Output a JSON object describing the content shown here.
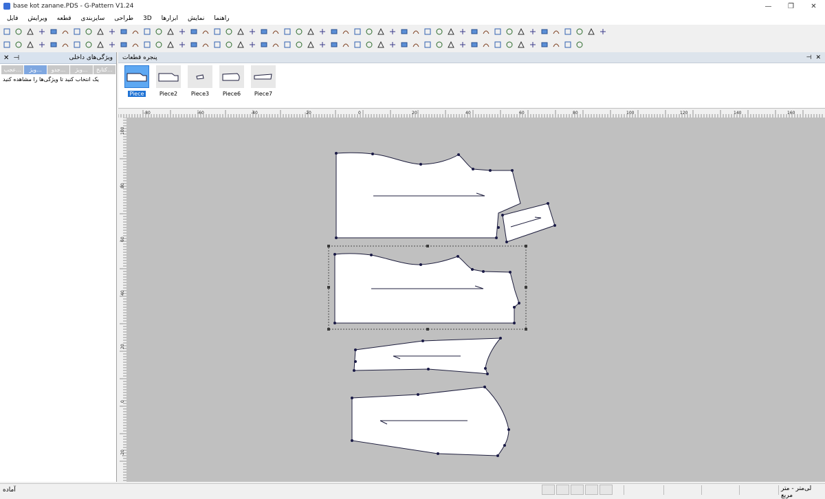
{
  "window": {
    "title": "base kot zanane.PDS - G-Pattern V1.24",
    "minimize": "—",
    "restore": "❐",
    "close": "✕"
  },
  "menu": [
    "راهنما",
    "نمایش",
    "ابزارها",
    "3D",
    "طراحی",
    "سایزبندی",
    "قطعه",
    "ویرایش",
    "فایل"
  ],
  "left_panel": {
    "title": "ویژگی‌های داخلی",
    "pin": "📌",
    "close": "✕",
    "tabs": [
      "عجب...",
      "ویژ...",
      "جدو...",
      "ویژ...",
      "کتابخ..."
    ],
    "message": "یک انتخاب کنید تا ویژگی‌ها را مشاهده کنید"
  },
  "pieces_window": {
    "title": "پنجره قطعات",
    "pin": "📌",
    "close": "✕",
    "items": [
      {
        "label": "Piece",
        "selected": true
      },
      {
        "label": "Piece2",
        "selected": false
      },
      {
        "label": "Piece3",
        "selected": false
      },
      {
        "label": "Piece6",
        "selected": false
      },
      {
        "label": "Piece7",
        "selected": false
      }
    ]
  },
  "rulers": {
    "top_labels": [
      "-80",
      "-60",
      "-40",
      "-20",
      "0",
      "20",
      "40",
      "60",
      "80",
      "100",
      "120",
      "140",
      "160"
    ],
    "left_labels": [
      "100",
      "80",
      "60",
      "40",
      "20",
      "0",
      "-20"
    ]
  },
  "status": {
    "left": "آماده",
    "right": "لی‌متر - متر مربع"
  },
  "toolbar_icons": {
    "row1": [
      "select-arrow-icon",
      "new-file-icon",
      "open-file-icon",
      "save-icon",
      "print-icon",
      "print-preview-icon",
      "plotter-icon",
      "export-icon",
      "import-icon",
      "zoom-icon",
      "zoom-fit-icon",
      "undo-icon",
      "redo-icon",
      "cut-icon",
      "copy-icon",
      "paste-icon",
      "properties-icon",
      "grade-icon",
      "help-icon",
      "angle-icon",
      "mirror-icon",
      "points-icon",
      "curve-icon",
      "dart-icon",
      "notch-icon",
      "seam-icon",
      "measure-icon",
      "tape-icon",
      "text-tool-icon",
      "pleat-icon",
      "fold-icon",
      "split-icon",
      "merge-icon",
      "rotate-icon",
      "rectangle-icon",
      "parallelogram-icon",
      "trapezoid-icon",
      "diamond-icon",
      "diamond2-icon",
      "triangle-icon",
      "right-triangle-icon",
      "pentagon-icon",
      "hexagon-icon",
      "circle-icon",
      "ellipse-icon",
      "octagon-icon",
      "match-icon",
      "walk-icon",
      "check-icon",
      "copy-piece-icon",
      "list-icon",
      "ruler-tool-icon"
    ],
    "row2": [
      "snap-icon",
      "grid-icon",
      "layer-icon",
      "mark-icon",
      "target-icon",
      "globe-icon",
      "text-icon",
      "wave-icon",
      "arc-icon",
      "heart-icon",
      "spline-icon",
      "bucket-icon",
      "drill-icon",
      "pen-icon",
      "line-icon",
      "sew-icon",
      "button-icon",
      "rotate-left-icon",
      "rotate-right-icon",
      "flip-icon",
      "align-icon",
      "play-icon",
      "scale-icon",
      "shoe-icon",
      "block-icon",
      "box-icon",
      "document-icon",
      "window-icon",
      "stack-icon",
      "frame-icon",
      "piece-icon",
      "view-icon",
      "clone-icon",
      "grid2-icon",
      "grid3-icon",
      "grid4-icon",
      "tile-icon",
      "layout-icon",
      "layout2-icon",
      "layout3-icon",
      "layout4-icon",
      "layout5-icon",
      "star-icon",
      "table-icon",
      "table2-icon",
      "calc-icon",
      "user-icon",
      "mirror2-icon",
      "zoom2-icon",
      "ruler2-icon"
    ]
  },
  "colors": {
    "canvas": "#c0c0c0",
    "piece_fill": "#ffffff",
    "outline": "#1c1c3c",
    "point": "#1a1a46",
    "selection": "#4a4a4a"
  }
}
